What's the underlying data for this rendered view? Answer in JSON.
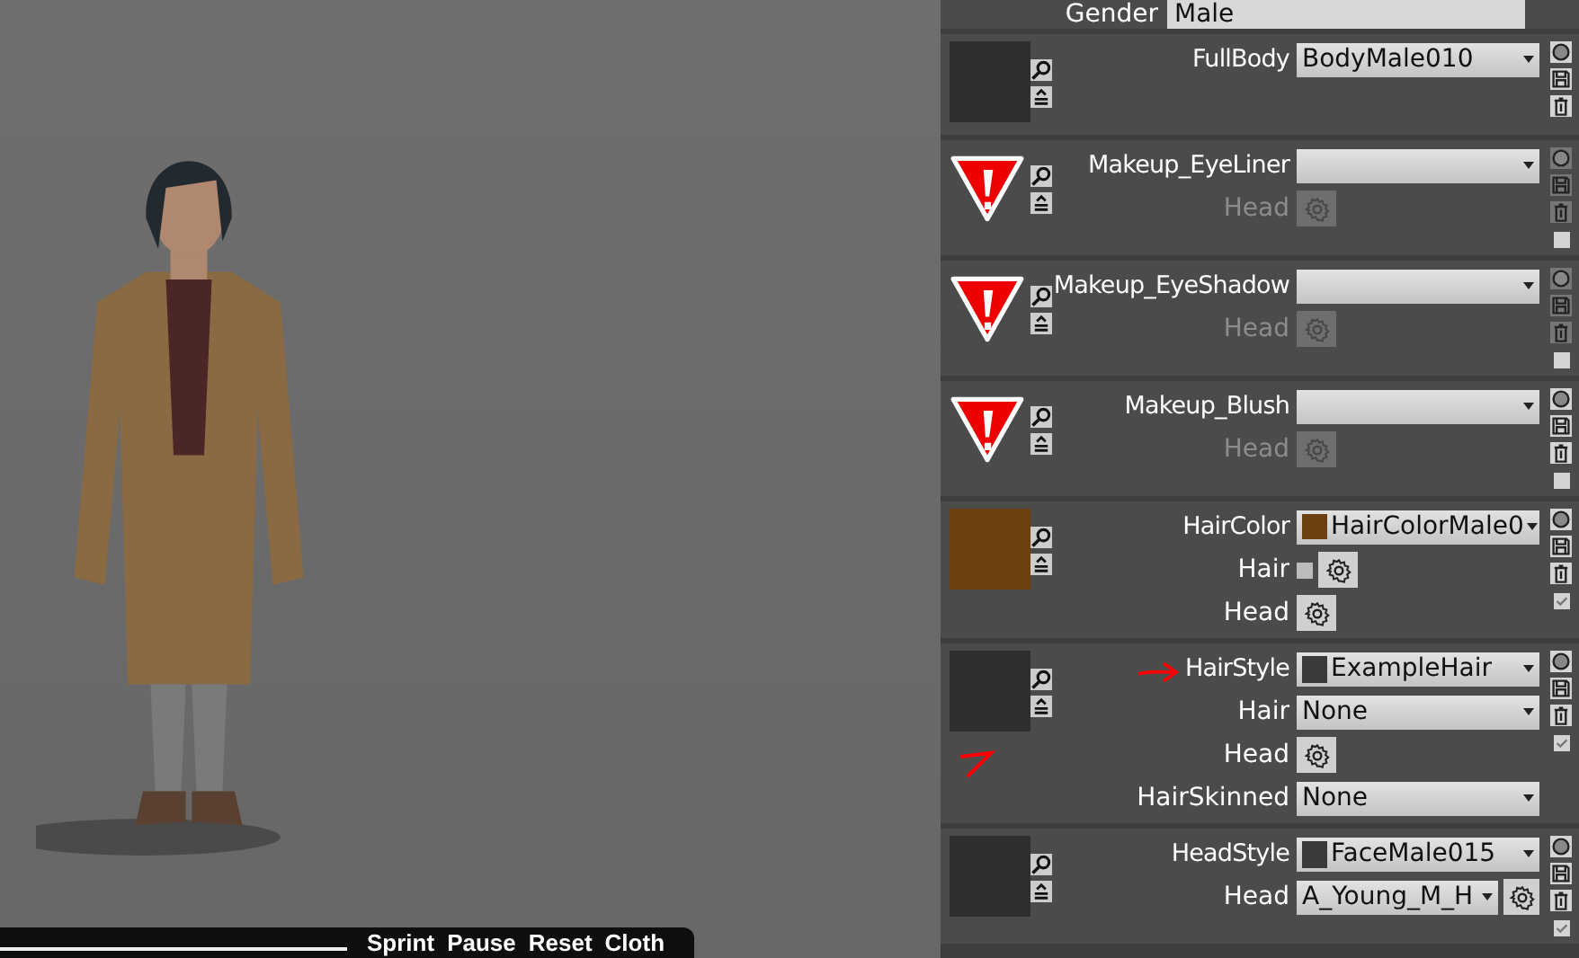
{
  "viewport": {
    "toolbar": [
      "Sprint",
      "Pause",
      "Reset",
      "Cloth"
    ]
  },
  "header": {
    "label": "Gender",
    "value": "Male"
  },
  "slots": [
    {
      "kind": "photo",
      "label": "FullBody",
      "value": "BodyMale010",
      "actions_disabled": false
    },
    {
      "kind": "warning",
      "label": "Makeup_EyeLiner",
      "actions_disabled": true,
      "checked": false,
      "rows": [
        {
          "kind": "gear",
          "label": "Head",
          "disabled": true
        }
      ]
    },
    {
      "kind": "warning",
      "label": "Makeup_EyeShadow",
      "actions_disabled": true,
      "checked": false,
      "rows": [
        {
          "kind": "gear",
          "label": "Head",
          "disabled": true
        }
      ]
    },
    {
      "kind": "warning",
      "label": "Makeup_Blush",
      "actions_disabled": false,
      "checked": false,
      "rows": [
        {
          "kind": "gear",
          "label": "Head",
          "disabled": true
        }
      ]
    },
    {
      "kind": "color",
      "color": "#6b4112",
      "label": "HairColor",
      "value": "HairColorMale0",
      "value_icon": {
        "kind": "swatch"
      },
      "actions_disabled": false,
      "checked": true,
      "rows": [
        {
          "kind": "toggle_gear",
          "label": "Hair",
          "checked": false
        },
        {
          "kind": "gear",
          "label": "Head",
          "disabled": false
        }
      ]
    },
    {
      "kind": "photo",
      "label": "HairStyle",
      "value": "ExampleHair",
      "value_icon": {
        "kind": "photo"
      },
      "annotated": true,
      "actions_disabled": false,
      "checked": true,
      "rows": [
        {
          "kind": "dropdown",
          "label": "Hair",
          "value": "None"
        },
        {
          "kind": "gear",
          "label": "Head",
          "disabled": false
        },
        {
          "kind": "dropdown",
          "label": "HairSkinned",
          "value": "None"
        }
      ]
    },
    {
      "kind": "photo",
      "label": "HeadStyle",
      "value": "FaceMale015",
      "value_icon": {
        "kind": "photo"
      },
      "actions_disabled": false,
      "checked": true,
      "rows": [
        {
          "kind": "dropdown_gear",
          "label": "Head",
          "value": "A_Young_M_H"
        }
      ]
    }
  ]
}
